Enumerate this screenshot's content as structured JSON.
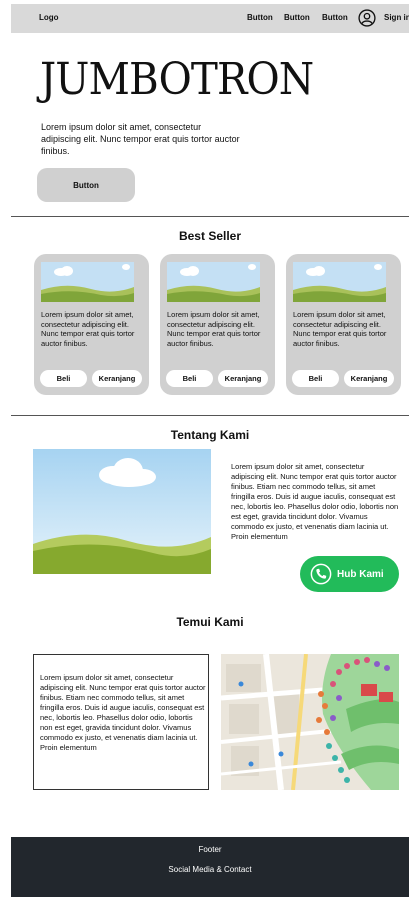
{
  "navbar": {
    "logo": "Logo",
    "buttons": [
      "Button",
      "Button",
      "Button"
    ],
    "signin": "Sign in",
    "user_icon": "user-circle-icon"
  },
  "jumbotron": {
    "title": "JUMBOTRON",
    "text": "Lorem ipsum dolor sit amet, consectetur adipiscing elit. Nunc tempor erat quis tortor auctor finibus.",
    "button": "Button"
  },
  "best_seller": {
    "title": "Best Seller",
    "cards": [
      {
        "text": "Lorem ipsum dolor sit amet, consectetur adipiscing elit. Nunc tempor erat quis tortor auctor finibus.",
        "buy": "Beli",
        "cart": "Keranjang"
      },
      {
        "text": "Lorem ipsum dolor sit amet, consectetur adipiscing elit. Nunc tempor erat quis tortor auctor finibus.",
        "buy": "Beli",
        "cart": "Keranjang"
      },
      {
        "text": "Lorem ipsum dolor sit amet, consectetur adipiscing elit. Nunc tempor erat quis tortor auctor finibus.",
        "buy": "Beli",
        "cart": "Keranjang"
      }
    ]
  },
  "about": {
    "title": "Tentang Kami",
    "text": "Lorem ipsum dolor sit amet, consectetur adipiscing elit. Nunc tempor erat quis tortor auctor finibus. Etiam nec commodo tellus, sit amet fringilla eros. Duis id augue iaculis, consequat est nec, lobortis leo. Phasellus dolor odio, lobortis non est eget, gravida tincidunt dolor. Vivamus commodo ex justo, et venenatis diam lacinia ut. Proin elementum",
    "hub_button": "Hub Kami"
  },
  "meet": {
    "title": "Temui Kami",
    "text": "Lorem ipsum dolor sit amet, consectetur adipiscing elit. Nunc tempor erat quis tortor auctor finibus. Etiam nec commodo tellus, sit amet fringilla eros. Duis id augue iaculis, consequat est nec, lobortis leo. Phasellus dolor odio, lobortis non est eget, gravida tincidunt dolor. Vivamus commodo ex justo, et venenatis diam lacinia ut. Proin elementum"
  },
  "footer": {
    "title": "Footer",
    "links": "Social Media & Contact"
  },
  "colors": {
    "navbar_bg": "#d9d9d9",
    "card_bg": "#d0d0d0",
    "hub_green": "#22bb5a",
    "footer_bg": "#22272d"
  }
}
